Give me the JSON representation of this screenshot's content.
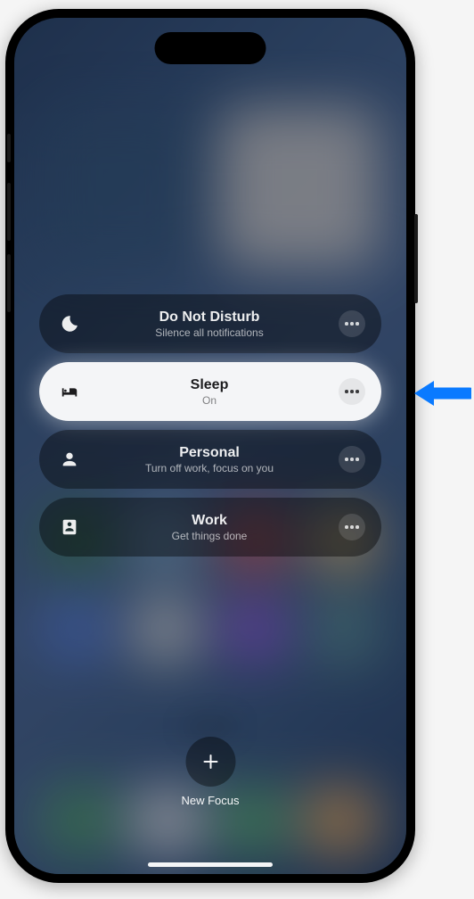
{
  "focus_modes": [
    {
      "id": "dnd",
      "title": "Do Not Disturb",
      "subtitle": "Silence all notifications",
      "icon": "moon",
      "active": false
    },
    {
      "id": "sleep",
      "title": "Sleep",
      "subtitle": "On",
      "icon": "bed",
      "active": true
    },
    {
      "id": "personal",
      "title": "Personal",
      "subtitle": "Turn off work, focus on you",
      "icon": "person",
      "active": false
    },
    {
      "id": "work",
      "title": "Work",
      "subtitle": "Get things done",
      "icon": "badge",
      "active": false
    }
  ],
  "new_focus_label": "New Focus",
  "callout_target": "sleep"
}
